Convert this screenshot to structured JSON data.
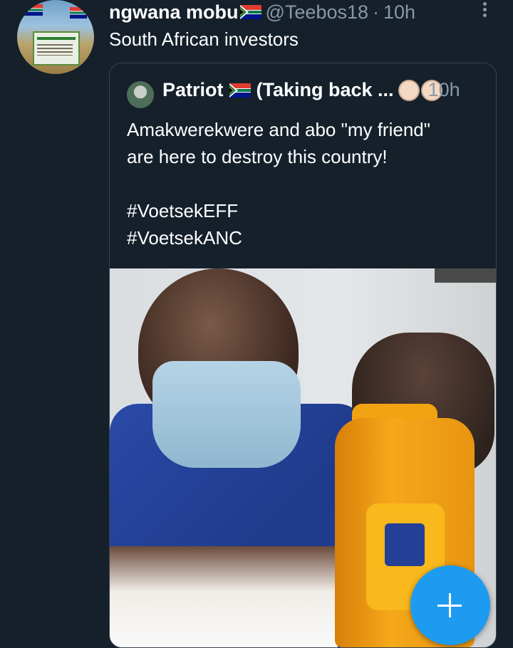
{
  "tweet": {
    "author_name": "ngwana mobu",
    "handle": "@Teebos18",
    "time_sep": "·",
    "time": "10h",
    "text": "South African investors"
  },
  "quoted_tweet": {
    "author_name": "Patriot",
    "display_title": "(Taking back ...",
    "time": "10h",
    "text": "Amakwerekwere and abo \"my friend\"\nare here to destroy this country!\n\n#VoetsekEFF\n#VoetsekANC"
  },
  "icons": {
    "more": "more-vertical-icon",
    "flag": "south-africa-flag-icon",
    "fist": "raised-fist-emoji-icon",
    "compose": "plus-icon"
  },
  "colors": {
    "background": "#15202b",
    "secondary_text": "#8899a6",
    "border": "#38444d",
    "accent": "#1d9bf0"
  }
}
